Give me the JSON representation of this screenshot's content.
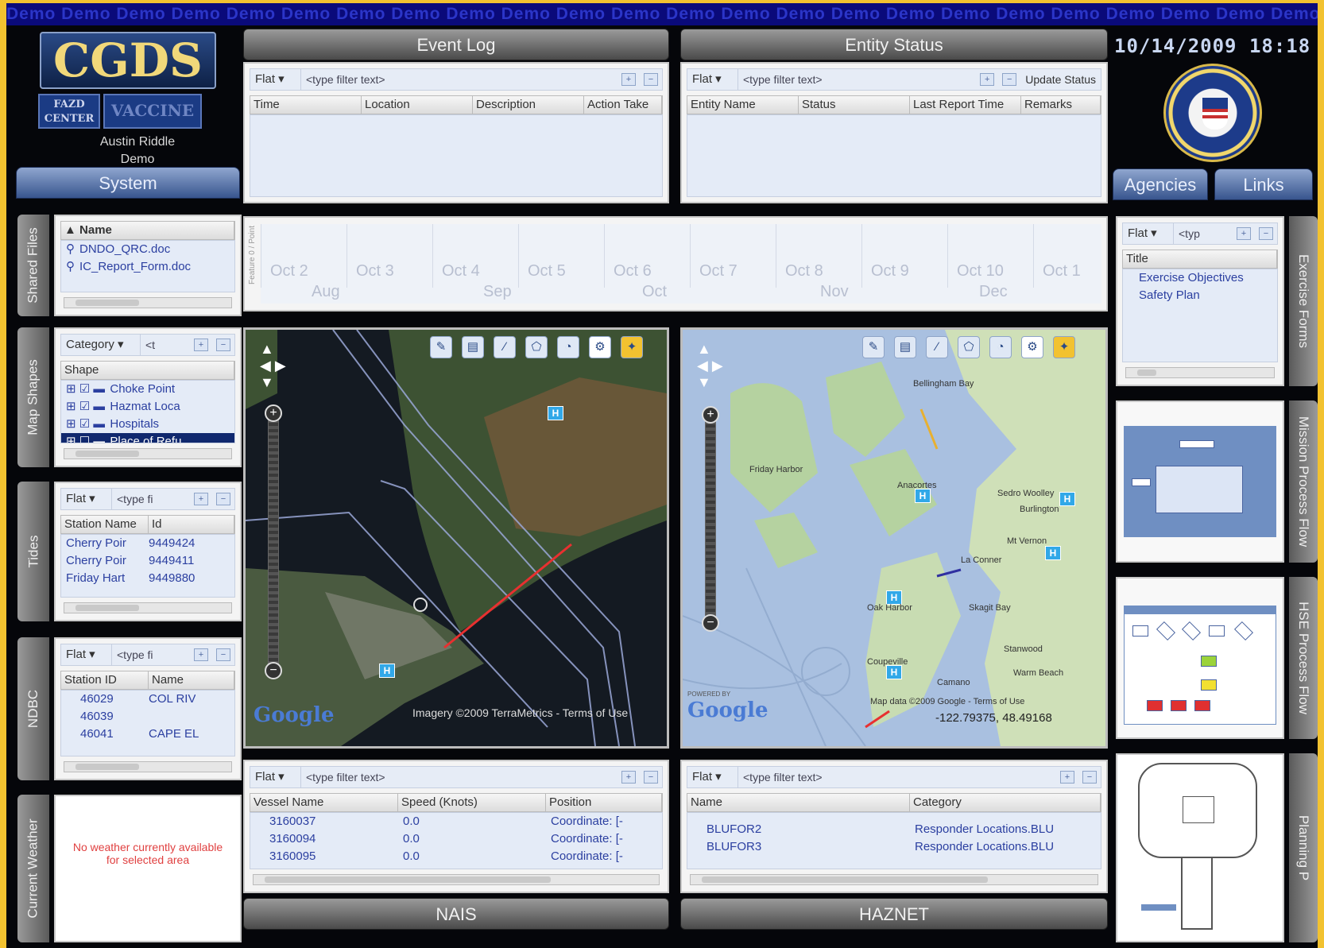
{
  "banner": {
    "text": "Demo Demo Demo Demo Demo Demo Demo Demo Demo Demo Demo Demo Demo Demo Demo Demo Demo Demo Demo Demo Demo Demo Demo Demo Demo Demo Demo"
  },
  "header": {
    "logo": "CGDS",
    "sub_left": "FAZD CENTER",
    "sub_right": "VACCINE",
    "user_name": "Austin Riddle",
    "user_role": "Demo",
    "datetime": "10/14/2009  18:18"
  },
  "nav": {
    "system": "System",
    "agencies": "Agencies",
    "links": "Links"
  },
  "event_log": {
    "title": "Event Log",
    "flat": "Flat",
    "filter_placeholder": "<type filter text>",
    "columns": [
      "Time",
      "Location",
      "Description",
      "Action Take"
    ]
  },
  "entity_status": {
    "title": "Entity Status",
    "flat": "Flat",
    "filter_placeholder": "<type filter text>",
    "update": "Update Status",
    "columns": [
      "Entity Name",
      "Status",
      "Last Report Time",
      "Remarks"
    ]
  },
  "side_tabs": {
    "shared_files": "Shared Files",
    "map_shapes": "Map Shapes",
    "tides": "Tides",
    "ndbc": "NDBC",
    "current_weather": "Current Weather",
    "exercise_forms": "Exercise Forms",
    "mission_process_flow": "Mission Process Flow",
    "hse_process_flow": "HSE Process Flow",
    "planning_p": "Planning P"
  },
  "shared_files": {
    "column": "Name",
    "files": [
      "DNDO_QRC.doc",
      "IC_Report_Form.doc"
    ]
  },
  "map_shapes": {
    "category": "Category",
    "column": "Shape",
    "items": [
      {
        "label": "Choke Point",
        "checked": true,
        "selected": false
      },
      {
        "label": "Hazmat Loca",
        "checked": true,
        "selected": false
      },
      {
        "label": "Hospitals",
        "checked": true,
        "selected": false
      },
      {
        "label": "Place of Refu",
        "checked": false,
        "selected": true
      }
    ]
  },
  "tides": {
    "flat": "Flat",
    "filter_placeholder": "<type fi",
    "columns": [
      "Station Name",
      "Id"
    ],
    "rows": [
      [
        "Cherry Poir",
        "9449424"
      ],
      [
        "Cherry Poir",
        "9449411"
      ],
      [
        "Friday Hart",
        "9449880"
      ]
    ]
  },
  "ndbc": {
    "flat": "Flat",
    "filter_placeholder": "<type fi",
    "columns": [
      "Station ID",
      "Name"
    ],
    "rows": [
      [
        "46029",
        "COL RIV"
      ],
      [
        "46039",
        ""
      ],
      [
        "46041",
        "CAPE EL"
      ]
    ]
  },
  "weather": {
    "message": "No weather currently available for selected area"
  },
  "timeline": {
    "axis_label": "Feature 0 / Point",
    "days": [
      "Oct 2",
      "Oct 3",
      "Oct 4",
      "Oct 5",
      "Oct 6",
      "Oct 7",
      "Oct 8",
      "Oct 9",
      "Oct 10",
      "Oct 1"
    ],
    "months": [
      "Aug",
      "Sep",
      "Oct",
      "Nov",
      "Dec"
    ]
  },
  "map_left": {
    "credit": "Imagery ©2009 TerraMetrics - Terms of Use",
    "google": "Google"
  },
  "map_right": {
    "places": [
      "Bellingham Bay",
      "Friday Harbor",
      "Anacortes",
      "Sedro Woolley",
      "Burlington",
      "Mt Vernon",
      "La Conner",
      "Oak Harbor",
      "Skagit Bay",
      "Stanwood",
      "Camano",
      "Coupeville",
      "Warm Beach"
    ],
    "credit": "Map data ©2009 Google - Terms of Use",
    "coords": "-122.79375, 48.49168",
    "powered": "POWERED BY",
    "google": "Google"
  },
  "nais": {
    "title": "NAIS",
    "flat": "Flat",
    "filter_placeholder": "<type filter text>",
    "columns": [
      "Vessel Name",
      "Speed (Knots)",
      "Position"
    ],
    "rows": [
      [
        "3160037",
        "0.0",
        "Coordinate: [-"
      ],
      [
        "3160094",
        "0.0",
        "Coordinate: [-"
      ],
      [
        "3160095",
        "0.0",
        "Coordinate: [-"
      ]
    ]
  },
  "haznet": {
    "title": "HAZNET",
    "flat": "Flat",
    "filter_placeholder": "<type filter text>",
    "columns": [
      "Name",
      "Category"
    ],
    "rows": [
      [
        "BLUFOR2",
        "Responder Locations.BLU"
      ],
      [
        "BLUFOR3",
        "Responder Locations.BLU"
      ]
    ]
  },
  "exercise_forms": {
    "flat": "Flat",
    "filter_placeholder": "<typ",
    "column": "Title",
    "items": [
      "Exercise Objectives",
      "Safety Plan"
    ]
  },
  "colors": {
    "accent": "#f2c230",
    "panel_blue": "#e4ebf7",
    "link": "#2b3fa0"
  }
}
